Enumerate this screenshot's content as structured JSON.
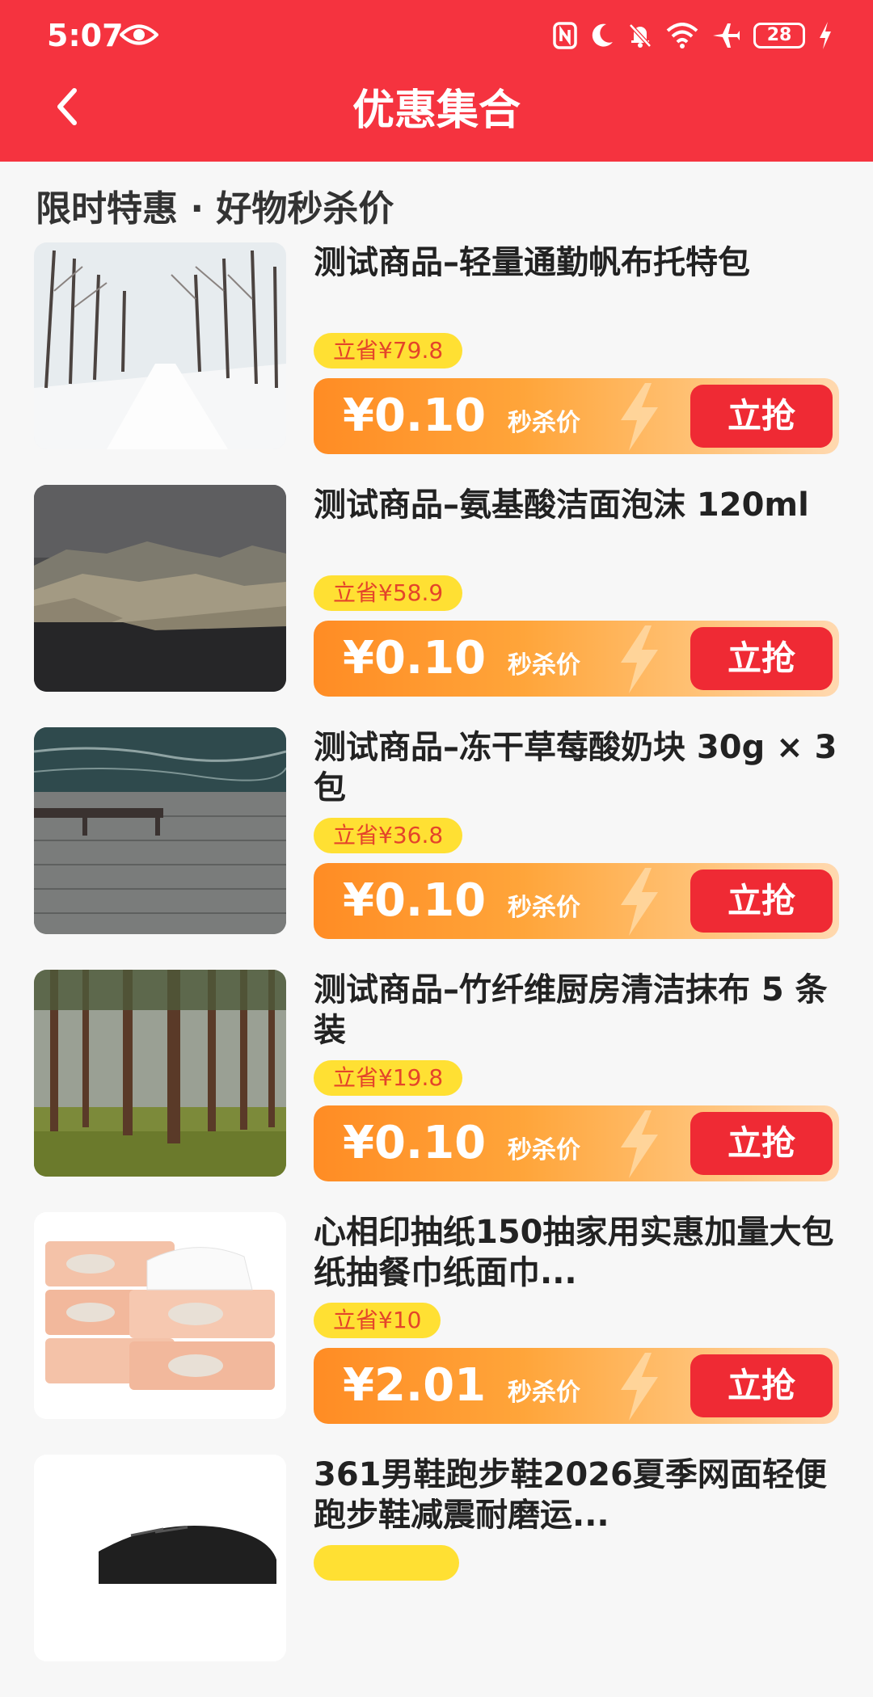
{
  "status_bar": {
    "time": "5:07",
    "battery": "28"
  },
  "nav": {
    "title": "优惠集合"
  },
  "section": {
    "title": "限时特惠 · 好物秒杀价"
  },
  "items": [
    {
      "title": "测试商品–轻量通勤帆布托特包",
      "save": "立省¥79.8",
      "price": "¥0.10",
      "price_label": "秒杀价",
      "button": "立抢",
      "image": "snowy-forest-road"
    },
    {
      "title": "测试商品–氨基酸洁面泡沫 120ml",
      "save": "立省¥58.9",
      "price": "¥0.10",
      "price_label": "秒杀价",
      "button": "立抢",
      "image": "coastal-cliffs"
    },
    {
      "title": "测试商品–冻干草莓酸奶块 30g × 3 包",
      "save": "立省¥36.8",
      "price": "¥0.10",
      "price_label": "秒杀价",
      "button": "立抢",
      "image": "lake-pier-bench"
    },
    {
      "title": "测试商品–竹纤维厨房清洁抹布 5 条装",
      "save": "立省¥19.8",
      "price": "¥0.10",
      "price_label": "秒杀价",
      "button": "立抢",
      "image": "pine-forest"
    },
    {
      "title": "心相印抽纸150抽家用实惠加量大包纸抽餐巾纸面巾...",
      "save": "立省¥10",
      "price": "¥2.01",
      "price_label": "秒杀价",
      "button": "立抢",
      "image": "tissue-packs"
    },
    {
      "title": "361男鞋跑步鞋2026夏季网面轻便跑步鞋减震耐磨运...",
      "save": "",
      "price": "",
      "price_label": "",
      "button": "",
      "image": "black-running-shoe"
    }
  ],
  "colors": {
    "header": "#f5333f",
    "save_badge": "#ffe033",
    "buy_button": "#ef2a34",
    "price_bar": "#ff8c24"
  }
}
